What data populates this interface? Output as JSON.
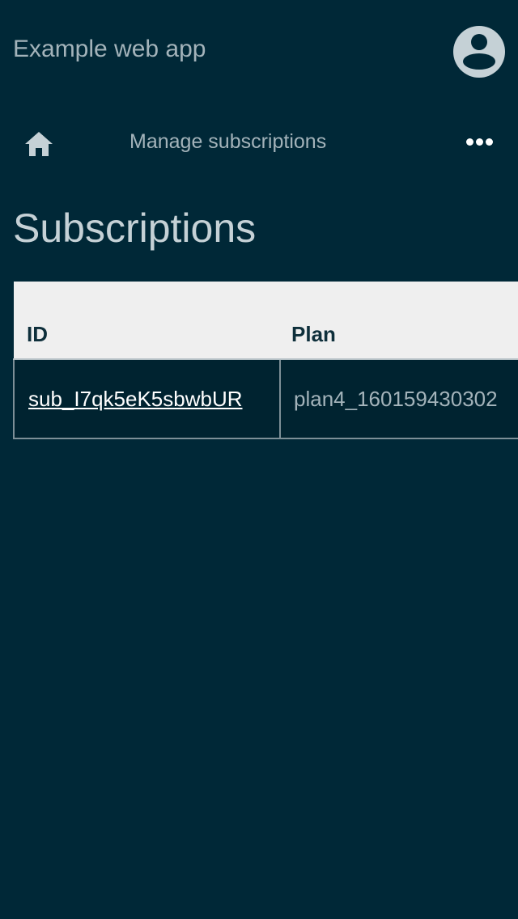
{
  "header": {
    "app_title": "Example web app",
    "avatar_icon": "account-circle-icon"
  },
  "nav": {
    "home_icon": "home-icon",
    "breadcrumb": "Manage subscriptions",
    "more_icon": "more-horizontal-icon"
  },
  "page": {
    "title": "Subscriptions"
  },
  "table": {
    "columns": [
      "ID",
      "Plan"
    ],
    "rows": [
      {
        "id": "sub_I7qk5eK5sbwbUR",
        "plan": "plan4_160159430302"
      }
    ]
  },
  "colors": {
    "background": "#002837",
    "header_row": "#efefef",
    "body_row": "#002330",
    "muted_text": "#a3b3ba",
    "link": "#ffffff"
  }
}
